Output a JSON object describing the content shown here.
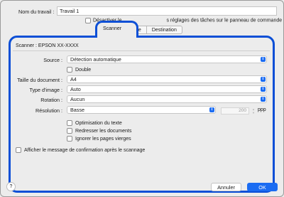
{
  "job": {
    "label": "Nom du travail :",
    "value": "Travail 1"
  },
  "disable_option": {
    "label_left": "Désactiver le",
    "label_right": "s réglages des tâches sur le panneau de commande"
  },
  "tabs": [
    {
      "label": "Scanner"
    },
    {
      "label": "rtie"
    },
    {
      "label": "Destination"
    }
  ],
  "scanner": {
    "label": "Scanner : EPSON XX-XXXX"
  },
  "fields": {
    "source": {
      "label": "Source :",
      "value": "Détection automatique"
    },
    "double": {
      "label": "Double"
    },
    "doc_size": {
      "label": "Taille du document :",
      "value": "A4"
    },
    "image_type": {
      "label": "Type d'image :",
      "value": "Auto"
    },
    "rotation": {
      "label": "Rotation :",
      "value": "Aucun"
    },
    "resolution": {
      "label": "Résolution :",
      "value": "Basse",
      "number": "200",
      "unit": "ppp"
    }
  },
  "options": {
    "text_opt": "Optimisation du texte",
    "straighten": "Redresser les documents",
    "skip_blank": "Ignorer les pages vierges"
  },
  "confirm": {
    "label": "Afficher le message de confirmation après le scannage"
  },
  "footer": {
    "help": "?",
    "cancel": "Annuler",
    "ok": "OK"
  },
  "colors": {
    "accent": "#1b6cf2",
    "highlight": "#0b4fd6"
  }
}
